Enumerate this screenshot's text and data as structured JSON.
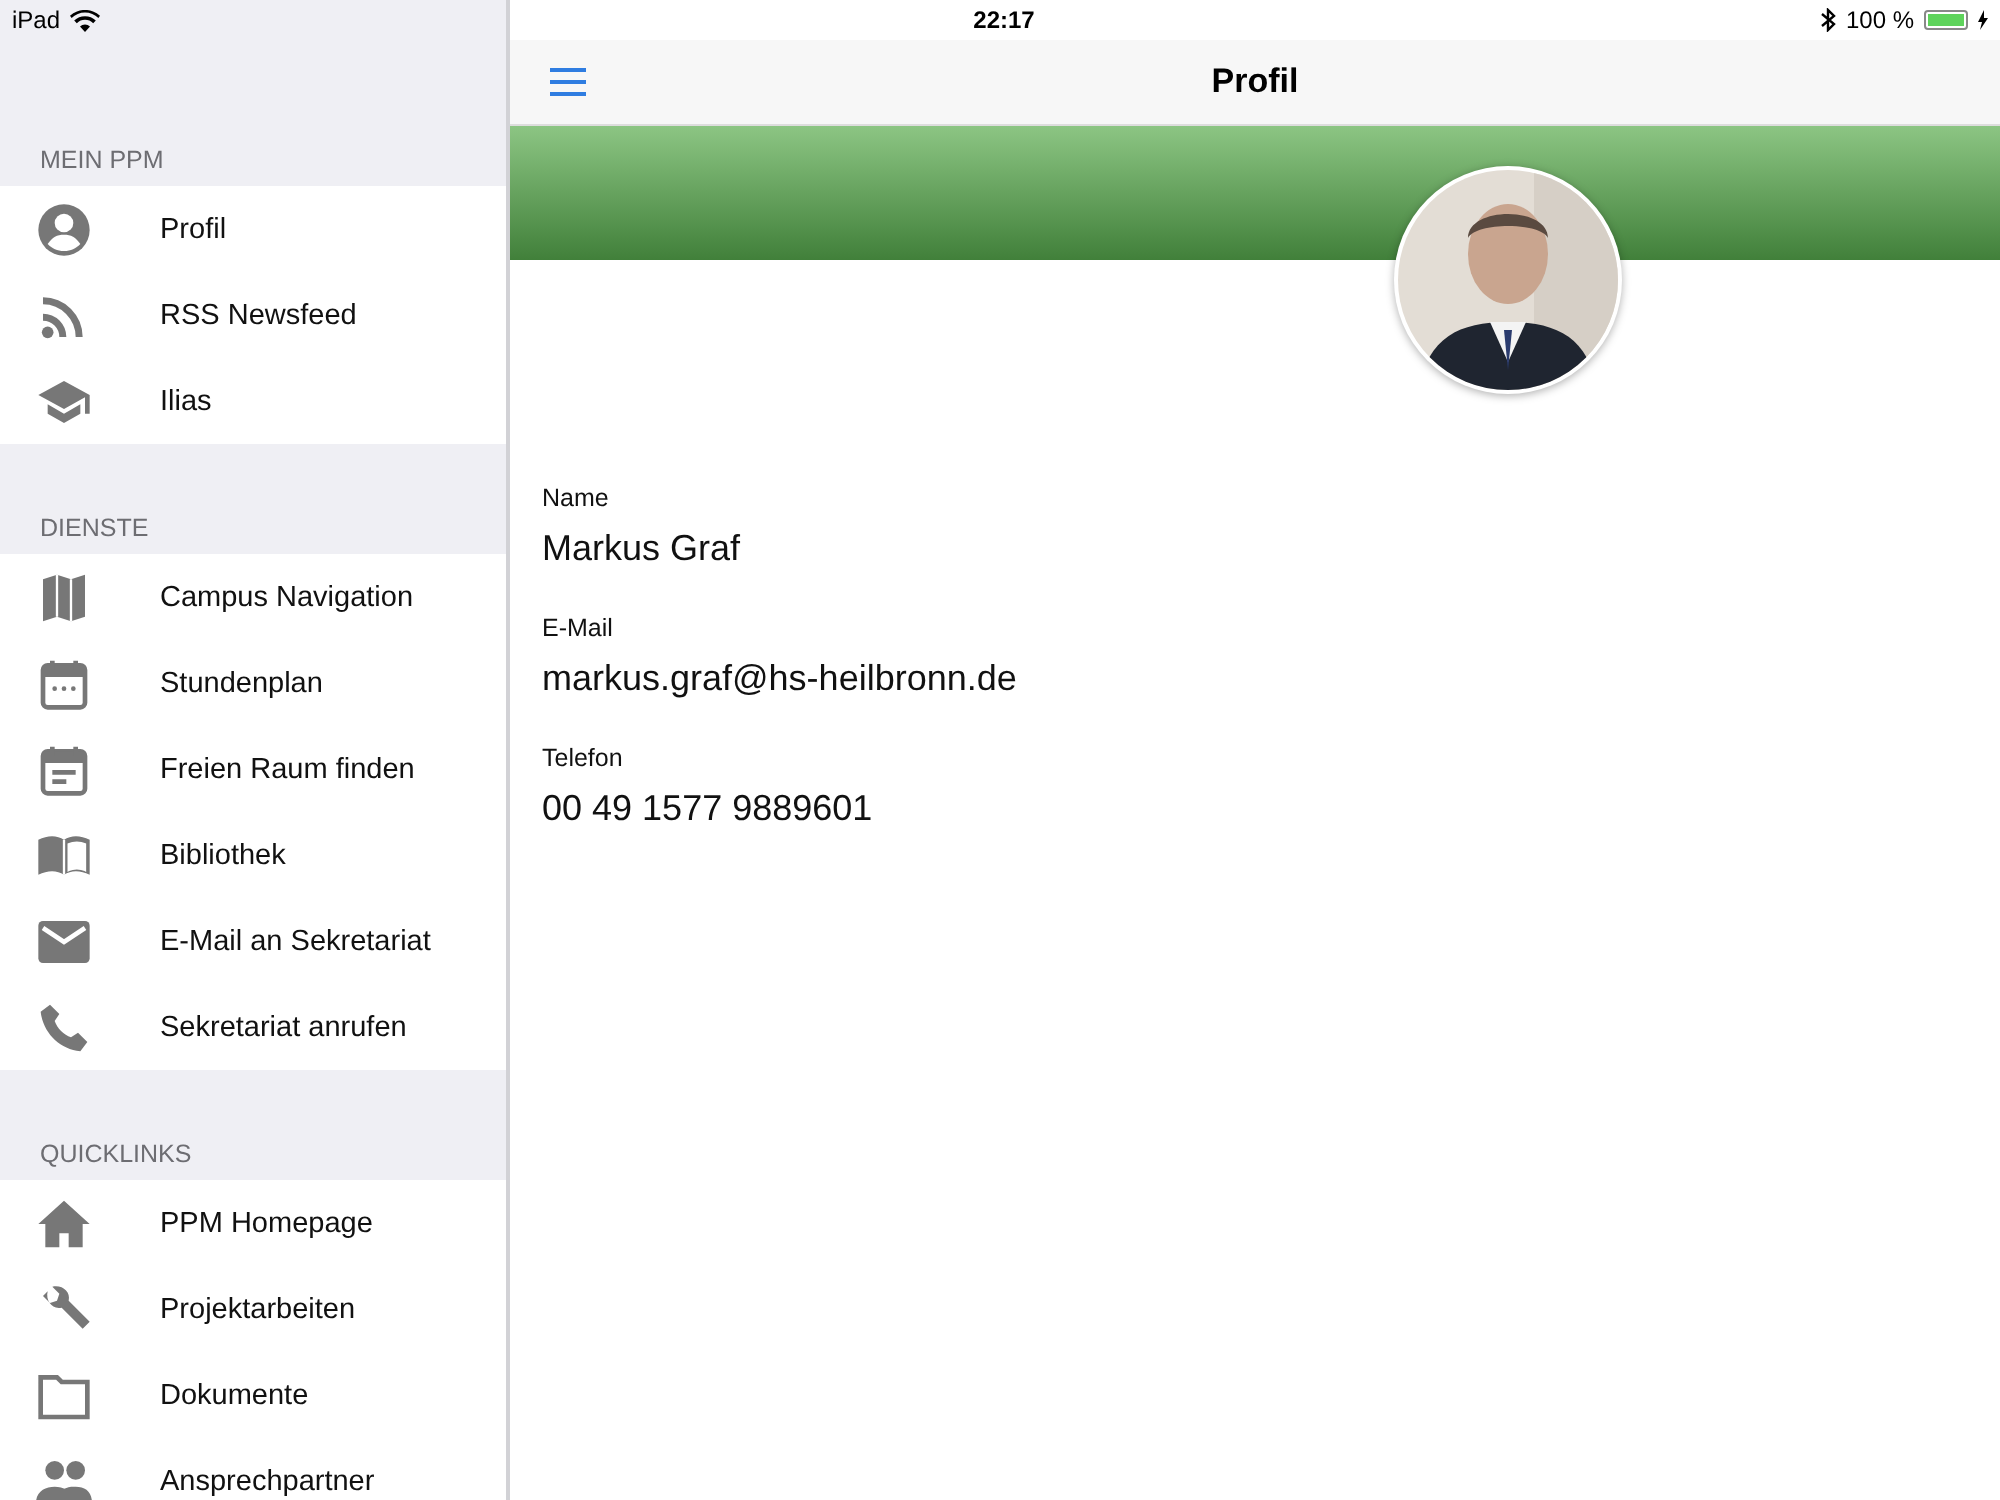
{
  "status_bar": {
    "device": "iPad",
    "time": "22:17",
    "battery": "100 %"
  },
  "sidebar": {
    "sections": [
      {
        "title": "MEIN PPM",
        "items": [
          {
            "label": "Profil"
          },
          {
            "label": "RSS Newsfeed"
          },
          {
            "label": "Ilias"
          }
        ]
      },
      {
        "title": "DIENSTE",
        "items": [
          {
            "label": "Campus Navigation"
          },
          {
            "label": "Stundenplan"
          },
          {
            "label": "Freien Raum finden"
          },
          {
            "label": "Bibliothek"
          },
          {
            "label": "E-Mail an Sekretariat"
          },
          {
            "label": "Sekretariat anrufen"
          }
        ]
      },
      {
        "title": "QUICKLINKS",
        "items": [
          {
            "label": "PPM Homepage"
          },
          {
            "label": "Projektarbeiten"
          },
          {
            "label": "Dokumente"
          },
          {
            "label": "Ansprechpartner"
          }
        ]
      }
    ]
  },
  "nav_bar": {
    "title": "Profil"
  },
  "profile": {
    "fields": [
      {
        "label": "Name",
        "value": "Markus Graf"
      },
      {
        "label": "E-Mail",
        "value": "markus.graf@hs-heilbronn.de"
      },
      {
        "label": "Telefon",
        "value": "00 49 1577 9889601"
      }
    ]
  }
}
